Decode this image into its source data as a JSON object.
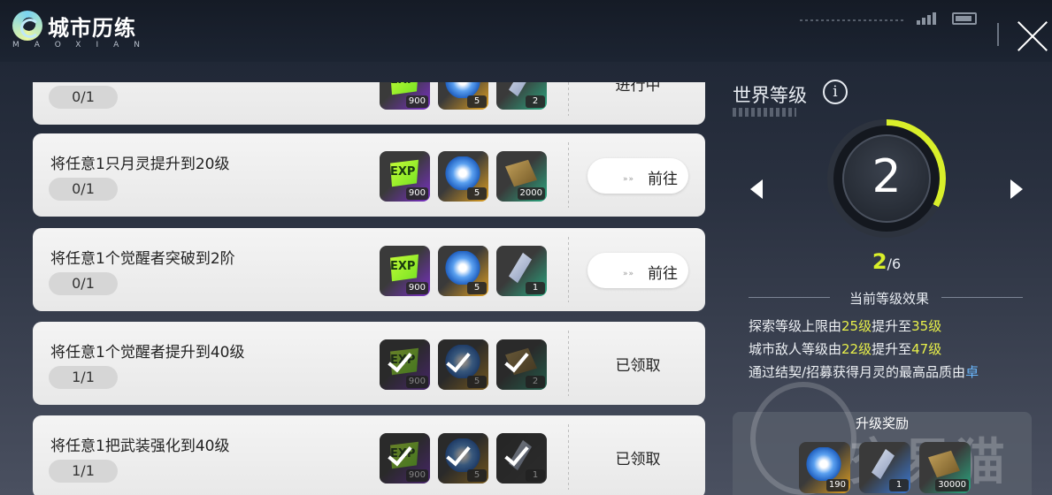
{
  "header": {
    "title": "城市历练",
    "subtitle": "MAOXIAN"
  },
  "tasks": [
    {
      "name": "",
      "progress": "0/1",
      "rewards": [
        {
          "icon": "exp-icon",
          "qty": "900"
        },
        {
          "icon": "crystal-icon",
          "qty": "5"
        },
        {
          "icon": "vial-icon",
          "qty": "2"
        }
      ],
      "action": "进行中",
      "action_type": "status"
    },
    {
      "name": "将任意1只月灵提升到20级",
      "progress": "0/1",
      "rewards": [
        {
          "icon": "exp-icon",
          "qty": "900"
        },
        {
          "icon": "crystal-icon",
          "qty": "5"
        },
        {
          "icon": "gold-ticket-icon",
          "qty": "2000"
        }
      ],
      "action": "前往",
      "action_type": "button"
    },
    {
      "name": "将任意1个觉醒者突破到2阶",
      "progress": "0/1",
      "rewards": [
        {
          "icon": "exp-icon",
          "qty": "900"
        },
        {
          "icon": "crystal-icon",
          "qty": "5"
        },
        {
          "icon": "vial-icon",
          "qty": "1"
        }
      ],
      "action": "前往",
      "action_type": "button"
    },
    {
      "name": "将任意1个觉醒者提升到40级",
      "progress": "1/1",
      "rewards": [
        {
          "icon": "exp-icon",
          "qty": "900"
        },
        {
          "icon": "crystal-icon",
          "qty": "5"
        },
        {
          "icon": "gold-ticket-icon",
          "qty": "2"
        }
      ],
      "action": "已领取",
      "action_type": "status"
    },
    {
      "name": "将任意1把武装强化到40级",
      "progress": "1/1",
      "rewards": [
        {
          "icon": "exp-icon",
          "qty": "900"
        },
        {
          "icon": "crystal-icon",
          "qty": "5"
        },
        {
          "icon": "vial-icon",
          "qty": "1"
        }
      ],
      "action": "已领取",
      "action_type": "status"
    }
  ],
  "world_level": {
    "title": "世界等级",
    "level": "2",
    "exp_current": "2",
    "exp_max": "/6",
    "ring_fraction": 0.33,
    "ring_color": "#d9ef2a"
  },
  "effects": {
    "title": "当前等级效果",
    "lines": [
      {
        "pre": "探索等级上限由",
        "a": "25级",
        "mid": "提升至",
        "b": "35级"
      },
      {
        "pre": "城市敌人等级由",
        "a": "22级",
        "mid": "提升至",
        "b": "47级"
      },
      {
        "pre": "通过结契/招募获得月灵的最高品质由",
        "a": "卓"
      }
    ]
  },
  "upgrade_rewards": {
    "title": "升级奖励",
    "items": [
      {
        "icon": "crystal-icon",
        "qty": "190"
      },
      {
        "icon": "potion-icon",
        "qty": "1"
      },
      {
        "icon": "gold-ticket-icon",
        "qty": "30000"
      }
    ]
  },
  "watermark": "交易猫"
}
